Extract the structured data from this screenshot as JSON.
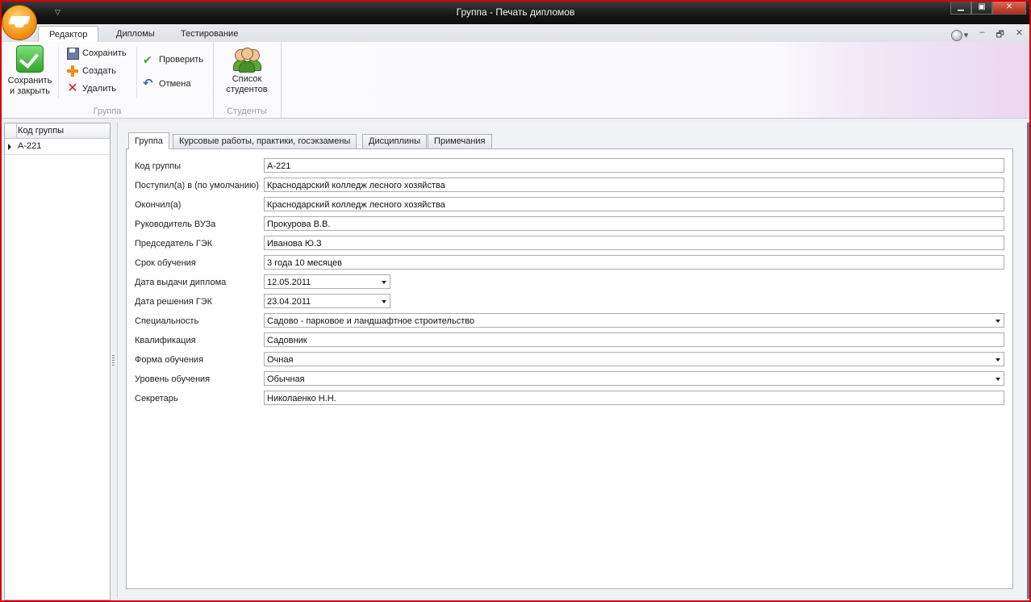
{
  "window": {
    "title": "Группа - Печать дипломов",
    "minimize": "▁",
    "restore": "▣",
    "close": "✕",
    "qat_arrow": "▽"
  },
  "ribbon_tabs": [
    {
      "label": "Редактор",
      "active": true
    },
    {
      "label": "Дипломы",
      "active": false
    },
    {
      "label": "Тестирование",
      "active": false
    }
  ],
  "tabstrip_right": {
    "dropdown": "▾",
    "minimize": "–",
    "restore": "🗗",
    "close": "✕"
  },
  "ribbon": {
    "groups": [
      {
        "label": "Группа"
      },
      {
        "label": "Студенты"
      }
    ],
    "save_close_line1": "Сохранить",
    "save_close_line2": "и закрыть",
    "save": "Сохранить",
    "create": "Создать",
    "delete": "Удалить",
    "check": "Проверить",
    "undo": "Отмена",
    "students_line1": "Список",
    "students_line2": "студентов"
  },
  "left_list": {
    "header": "Код группы",
    "rows": [
      "А-221"
    ]
  },
  "panel_tabs": [
    {
      "label": "Группа",
      "active": true
    },
    {
      "label": "Курсовые работы, практики, госэкзамены",
      "active": false
    },
    {
      "label": "Дисциплины",
      "active": false
    },
    {
      "label": "Примечания",
      "active": false
    }
  ],
  "form": {
    "fields": [
      {
        "label": "Код группы",
        "value": "А-221",
        "kind": "text"
      },
      {
        "label": "Поступил(а) в (по умолчанию)",
        "value": "Краснодарский колледж лесного хозяйства",
        "kind": "text"
      },
      {
        "label": "Окончил(а)",
        "value": "Краснодарский колледж лесного хозяйства",
        "kind": "text"
      },
      {
        "label": "Руководитель ВУЗа",
        "value": "Прокурова В.В.",
        "kind": "text"
      },
      {
        "label": "Председатель ГЭК",
        "value": "Иванова Ю.З",
        "kind": "text"
      },
      {
        "label": "Срок обучения",
        "value": "3 года 10 месяцев",
        "kind": "text"
      },
      {
        "label": "Дата выдачи диплома",
        "value": "12.05.2011",
        "kind": "date"
      },
      {
        "label": "Дата решения ГЭК",
        "value": "23.04.2011",
        "kind": "date"
      },
      {
        "label": "Специальность",
        "value": "Садово - парковое и ландшафтное строительство",
        "kind": "select"
      },
      {
        "label": "Квалификация",
        "value": "Садовник",
        "kind": "text"
      },
      {
        "label": "Форма обучения",
        "value": "Очная",
        "kind": "select"
      },
      {
        "label": "Уровень обучения",
        "value": "Обычная",
        "kind": "select"
      },
      {
        "label": "Секретарь",
        "value": "Николаенко Н.Н.",
        "kind": "text"
      }
    ]
  }
}
